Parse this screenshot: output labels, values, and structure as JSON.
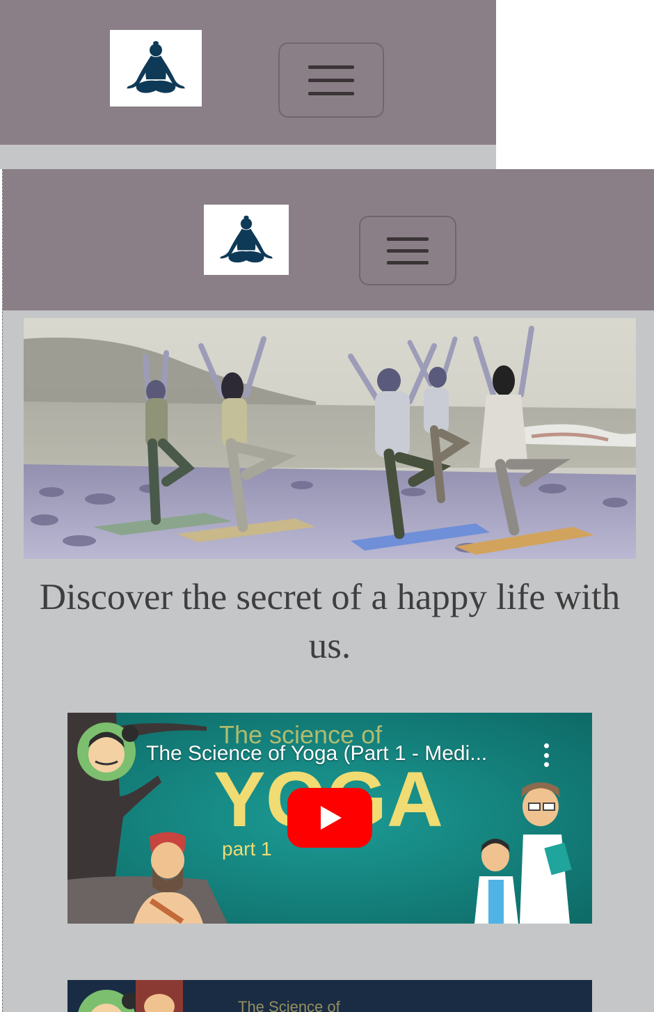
{
  "colors": {
    "navbar": "#8a7f86",
    "page_background": "#c5c6c8",
    "logo_figure": "#0f3a57",
    "youtube_red": "#ff0000"
  },
  "icons": {
    "logo": "meditation-figure-icon",
    "menu": "hamburger-menu-icon",
    "play": "youtube-play-icon",
    "more": "vertical-dots-icon"
  },
  "hero": {
    "alt": "People doing tree pose yoga on a rocky beach"
  },
  "tagline": "Discover the secret of a happy life with us.",
  "videos": [
    {
      "title": "The Science of Yoga (Part 1 - Medi...",
      "thumbnail_heading": "The science of",
      "thumbnail_big": "YOGA",
      "thumbnail_part": "part 1"
    },
    {
      "title": "",
      "thumbnail_heading": "The Science of"
    }
  ]
}
